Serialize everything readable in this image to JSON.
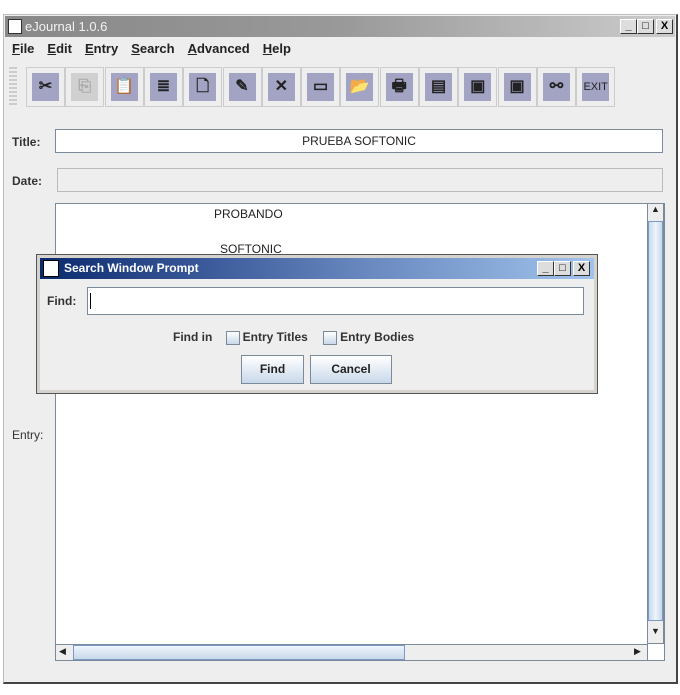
{
  "window": {
    "title": "eJournal 1.0.6",
    "min": "_",
    "max": "□",
    "close": "X"
  },
  "menu": [
    "File",
    "Edit",
    "Entry",
    "Search",
    "Advanced",
    "Help"
  ],
  "toolbar": [
    {
      "icon": "cut-icon",
      "g": "✂"
    },
    {
      "icon": "copy-icon",
      "g": "⎘",
      "disabled": true
    },
    {
      "icon": "paste-icon",
      "g": "📋"
    },
    {
      "icon": "text-format-icon",
      "g": "≣"
    },
    {
      "icon": "new-entry-icon",
      "g": "🗋"
    },
    {
      "icon": "edit-entry-icon",
      "g": "✎"
    },
    {
      "icon": "delete-icon",
      "g": "✕"
    },
    {
      "icon": "folder-icon",
      "g": "▭"
    },
    {
      "icon": "open-folder-icon",
      "g": "📂"
    },
    {
      "icon": "print-icon",
      "g": "🖶"
    },
    {
      "icon": "export-icon",
      "g": "▤"
    },
    {
      "icon": "save-icon",
      "g": "▣"
    },
    {
      "icon": "save-all-icon",
      "g": "▣"
    },
    {
      "icon": "search-binoculars-icon",
      "g": "⚯"
    },
    {
      "icon": "exit-icon",
      "g": "EXIT"
    }
  ],
  "form": {
    "title_label": "Title:",
    "title_value": "PRUEBA SOFTONIC",
    "date_label": "Date:",
    "date_value": "",
    "entry_label": "Entry:",
    "entry_lines": [
      "PROBANDO",
      "SOFTONIC"
    ]
  },
  "dialog": {
    "title": "Search Window Prompt",
    "find_label": "Find:",
    "find_value": "",
    "find_in": "Find in",
    "opt_titles": "Entry Titles",
    "opt_bodies": "Entry Bodies",
    "find_btn": "Find",
    "cancel_btn": "Cancel"
  }
}
